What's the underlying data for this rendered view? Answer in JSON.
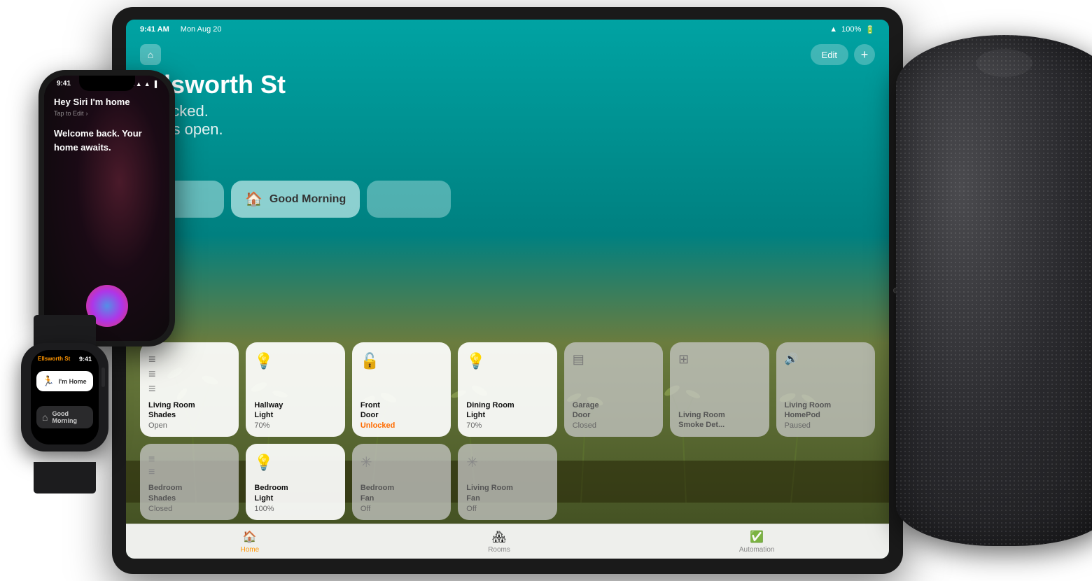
{
  "scene": {
    "background": "#f0f0f0"
  },
  "ipad": {
    "statusbar": {
      "time": "9:41 AM",
      "date": "Mon Aug 20",
      "wifi": "WiFi",
      "battery": "100%"
    },
    "title": "Ellsworth St",
    "subtitle_line1": "Unlocked.",
    "subtitle_line2": "blinds open.",
    "nav": {
      "edit_label": "Edit",
      "plus_label": "+"
    },
    "scenes": [
      {
        "icon": "☀️",
        "label": "Good Morning"
      }
    ],
    "tiles": [
      {
        "row": 1,
        "col": 1,
        "icon": "≡",
        "icon_color": "#888",
        "name": "Living Room Shades",
        "status": "Open",
        "status_color": "#555",
        "dark": false
      },
      {
        "row": 1,
        "col": 2,
        "icon": "💡",
        "icon_color": "#FFD700",
        "name": "Hallway Light",
        "status": "70%",
        "status_color": "#555",
        "dark": false
      },
      {
        "row": 1,
        "col": 3,
        "icon": "🔓",
        "icon_color": "#FF6B00",
        "name": "Front Door",
        "status": "Unlocked",
        "status_color": "#FF6B00",
        "dark": false,
        "status_highlight": true
      },
      {
        "row": 1,
        "col": 4,
        "icon": "💡",
        "icon_color": "#FFD700",
        "name": "Dining Room Light",
        "status": "70%",
        "status_color": "#555",
        "dark": false
      },
      {
        "row": 1,
        "col": 5,
        "icon": "🚗",
        "icon_color": "#888",
        "name": "Garage Door",
        "status": "Closed",
        "status_color": "#666",
        "dark": true
      },
      {
        "row": 1,
        "col": 6,
        "icon": "🔥",
        "icon_color": "#888",
        "name": "Living Room Smoke Det...",
        "status": "",
        "dark": true
      },
      {
        "row": 1,
        "col": 7,
        "icon": "🔊",
        "icon_color": "#888",
        "name": "Living Room HomePod",
        "status": "Paused",
        "status_color": "#666",
        "dark": true
      },
      {
        "row": 2,
        "col": 1,
        "icon": "≡",
        "icon_color": "#888",
        "name": "Bedroom Shades",
        "status": "Closed",
        "status_color": "#666",
        "dark": true
      },
      {
        "row": 2,
        "col": 2,
        "icon": "💡",
        "icon_color": "#FFD700",
        "name": "Bedroom Light",
        "status": "100%",
        "status_color": "#555",
        "dark": false,
        "bold_name": true
      },
      {
        "row": 2,
        "col": 3,
        "icon": "🌀",
        "icon_color": "#888",
        "name": "Bedroom Fan",
        "status": "Off",
        "status_color": "#666",
        "dark": true
      },
      {
        "row": 2,
        "col": 4,
        "icon": "🌀",
        "icon_color": "#888",
        "name": "Living Room Fan",
        "status": "Off",
        "status_color": "#666",
        "dark": true
      }
    ],
    "tabbar": [
      {
        "icon": "🏠",
        "label": "Home",
        "active": true
      },
      {
        "icon": "🏘",
        "label": "Rooms",
        "active": false
      },
      {
        "icon": "✅",
        "label": "Automation",
        "active": false
      }
    ]
  },
  "iphone": {
    "statusbar": {
      "time": "9:41",
      "signal": "●●●●",
      "wifi": "WiFi",
      "battery": "■"
    },
    "siri": {
      "command": "Hey Siri I'm home",
      "tap_to_edit": "Tap to Edit",
      "response_line1": "Welcome back. Your",
      "response_line2": "home awaits."
    }
  },
  "watch": {
    "location": "Ellsworth St",
    "time": "9:41",
    "card_icon": "🏃",
    "card_label": "I'm Home",
    "scene_icon": "⌂",
    "scene_label": "Good Morning"
  },
  "homepod": {
    "label": "HomePod"
  }
}
